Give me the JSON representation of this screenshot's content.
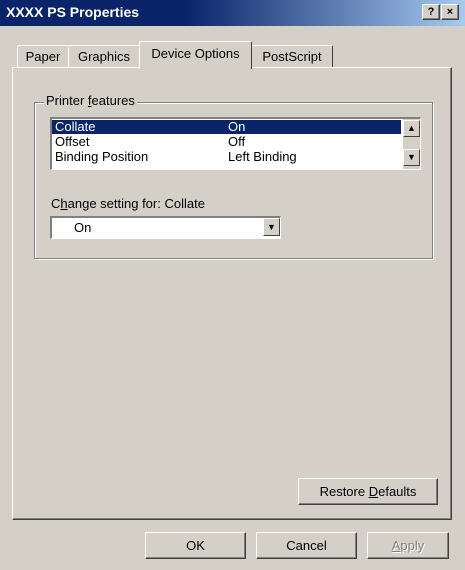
{
  "window": {
    "title": "XXXX PS Properties",
    "help_label": "?",
    "close_label": "×"
  },
  "tabs": [
    {
      "label": "Paper",
      "active": false
    },
    {
      "label": "Graphics",
      "active": false
    },
    {
      "label": "Device Options",
      "active": true
    },
    {
      "label": "PostScript",
      "active": false
    }
  ],
  "printer_features": {
    "group_label_pre": "Printer ",
    "group_label_u": "f",
    "group_label_post": "eatures",
    "items": [
      {
        "name": "Collate",
        "value": "On",
        "selected": true
      },
      {
        "name": "Offset",
        "value": "Off",
        "selected": false
      },
      {
        "name": "Binding Position",
        "value": "Left Binding",
        "selected": false
      }
    ],
    "scroll_up_glyph": "▲",
    "scroll_down_glyph": "▼"
  },
  "change_setting": {
    "label_pre": "C",
    "label_u": "h",
    "label_post": "ange setting for:  Collate",
    "selected_value": "On",
    "drop_glyph": "▼"
  },
  "buttons": {
    "restore_pre": "Restore ",
    "restore_u": "D",
    "restore_post": "efaults",
    "ok": "OK",
    "cancel": "Cancel",
    "apply_u": "A",
    "apply_post": "pply"
  },
  "colors": {
    "title_bar": "#0a246a",
    "dialog_face": "#d4d0c8",
    "selection": "#0a246a"
  }
}
